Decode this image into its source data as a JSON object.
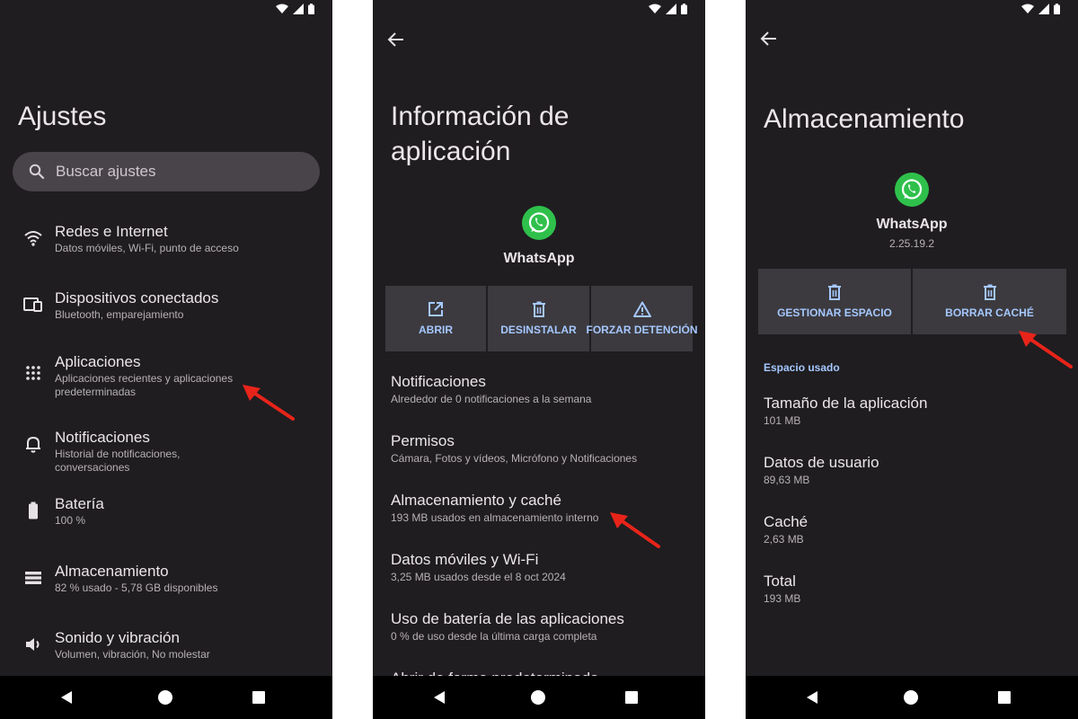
{
  "colors": {
    "background": "#1f1d20",
    "accent": "#a5c8ff",
    "whatsapp_green": "#2fc04b",
    "arrow": "#e8241a"
  },
  "screen1": {
    "title": "Ajustes",
    "search_placeholder": "Buscar ajustes",
    "items": [
      {
        "icon": "wifi-icon",
        "title": "Redes e Internet",
        "subtitle": "Datos móviles, Wi-Fi, punto de acceso"
      },
      {
        "icon": "devices-icon",
        "title": "Dispositivos conectados",
        "subtitle": "Bluetooth, emparejamiento"
      },
      {
        "icon": "apps-grid-icon",
        "title": "Aplicaciones",
        "subtitle": "Aplicaciones recientes y aplicaciones predeterminadas"
      },
      {
        "icon": "bell-icon",
        "title": "Notificaciones",
        "subtitle": "Historial de notificaciones, conversaciones"
      },
      {
        "icon": "battery-icon",
        "title": "Batería",
        "subtitle": "100 %"
      },
      {
        "icon": "storage-icon",
        "title": "Almacenamiento",
        "subtitle": "82 % usado - 5,78 GB disponibles"
      },
      {
        "icon": "volume-icon",
        "title": "Sonido y vibración",
        "subtitle": "Volumen, vibración, No molestar"
      }
    ]
  },
  "screen2": {
    "title_line1": "Información de",
    "title_line2": "aplicación",
    "app_name": "WhatsApp",
    "actions": [
      {
        "icon": "open-external-icon",
        "label": "ABRIR"
      },
      {
        "icon": "trash-icon",
        "label": "DESINSTALAR"
      },
      {
        "icon": "warning-icon",
        "label": "FORZAR DETENCIÓN"
      }
    ],
    "items": [
      {
        "title": "Notificaciones",
        "subtitle": "Alrededor de 0 notificaciones a la semana"
      },
      {
        "title": "Permisos",
        "subtitle": "Cámara, Fotos y vídeos, Micrófono y Notificaciones"
      },
      {
        "title": "Almacenamiento y caché",
        "subtitle": "193 MB usados en almacenamiento interno"
      },
      {
        "title": "Datos móviles y Wi-Fi",
        "subtitle": "3,25 MB usados desde el 8 oct 2024"
      },
      {
        "title": "Uso de batería de las aplicaciones",
        "subtitle": "0 % de uso desde la última carga completa"
      },
      {
        "title": "Abrir de forma predeterminada",
        "subtitle": ""
      }
    ]
  },
  "screen3": {
    "title": "Almacenamiento",
    "app_name": "WhatsApp",
    "app_version": "2.25.19.2",
    "actions": [
      {
        "icon": "trash-icon",
        "label": "GESTIONAR ESPACIO"
      },
      {
        "icon": "trash-icon",
        "label": "BORRAR CACHÉ"
      }
    ],
    "section_header": "Espacio usado",
    "items": [
      {
        "title": "Tamaño de la aplicación",
        "subtitle": "101 MB"
      },
      {
        "title": "Datos de usuario",
        "subtitle": "89,63 MB"
      },
      {
        "title": "Caché",
        "subtitle": "2,63 MB"
      },
      {
        "title": "Total",
        "subtitle": "193 MB"
      }
    ]
  }
}
